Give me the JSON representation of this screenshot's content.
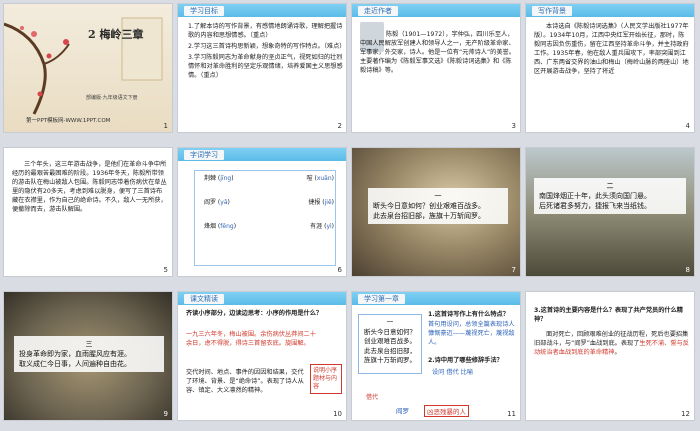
{
  "colors": {
    "header": "#5bbce8",
    "accent_red": "#d0382b",
    "accent_blue": "#2d63b8"
  },
  "slides": [
    {
      "num": "1",
      "title": "2 梅岭三章",
      "author": "部编版·九年级语文下册",
      "footer": "第一PPT模板网-WWW.1PPT.COM"
    },
    {
      "num": "2",
      "tag": "学习目标",
      "items": [
        "1.了解本诗的写作背景，有感情地朗诵诗歌，理解把握诗歌的内容和思想情感。（重点）",
        "2.学习这三首诗构思新颖，想象奇特的写作特点。（难点）",
        "3.学习陈毅同志为革命献身的坚贞正气，视死如归的壮烈情怀和对革命胜利的坚定乐观情绪，培养爱国主义思想感情。（重点）"
      ]
    },
    {
      "num": "3",
      "tag": "走近作者",
      "text": "陈毅（1901—1972），字仲弘，四川乐至人，中国人民解放军创建人和领导人之一，无产阶级革命家、军事家，外交家，诗人。他是一位有“元帅诗人”的美誉。主要著作编为《陈毅军事文选》《陈毅诗词选集》和《陈毅诗稿》等。"
    },
    {
      "num": "4",
      "tag": "写作背景",
      "text": "本诗选自《陈毅诗词选集》（人民文学出版社1977年版）。1934年10月，江西中央红军开始长征，那时，陈毅同志因负伤重伤，留在江西坚持革命斗争，并主持政府工作。1935年春，他在敌人重兵围攻下，率部突围到江西、广东两省交界的油山和梅山（梅岭山脉的两座山）地区开展游击战争，坚持了将近"
    },
    {
      "num": "5",
      "text": "三个年头，这三年游击战争，是他们在革命斗争中所经历的最艰苦最困难的阶段。1936年冬天，陈毅所带领的游击队在梅山被敌人包围。陈毅同志带着伤病伏在草丛里的隐伏有20多天，考虑到难以脱身，便写了三首诗布藏在衣襟里，作为自己的绝命诗。不久，敌人一无所获，便撤除而去，游击队解围。"
    },
    {
      "num": "6",
      "tag": "字词学习",
      "words": [
        {
          "py": "jīng",
          "w": "荆棘"
        },
        {
          "py": "xuān",
          "w": "喧"
        },
        {
          "py": "yā",
          "w": "阎罗"
        },
        {
          "py": "jiē",
          "w": "捷报"
        },
        {
          "py": "fēng",
          "w": "烽烟"
        },
        {
          "py": "yì",
          "w": "有涯"
        }
      ]
    },
    {
      "num": "7",
      "poem_no": "一",
      "lines": [
        "断头今日意如何？创业艰难百战多。",
        "此去泉台招旧部，旌旗十万斩阎罗。"
      ]
    },
    {
      "num": "8",
      "poem_no": "二",
      "lines": [
        "南国烽烟正十年，此头须向国门悬。",
        "后死诸君多努力，捷报飞来当纸钱。"
      ]
    },
    {
      "num": "9",
      "poem_no": "三",
      "lines": [
        "投身革命即为家，血雨腥风应有涯。",
        "取义成仁今日事，人间遍种自由花。"
      ]
    },
    {
      "num": "10",
      "tag": "课文精读",
      "question": "齐读小序部分，边读边思考：小序的作用是什么？",
      "quote": "一九三六年冬，梅山被围。余伤病伏丛莽间二十余日，虑不得脱，得诗三首留衣底。旋围解。",
      "answer": "交代时间、地点、事件的因因和结果，交代了环境、背景、是“绝命诗”。表现了诗人从容、镇定、大义凛然的精神。",
      "callout": "说明小序题材与内容"
    },
    {
      "num": "11",
      "tag": "学习第一章",
      "lines": [
        "一",
        "断头今日意如何？",
        "创业艰难百战多。",
        "此去泉台招旧部，",
        "旌旗十万斩阎罗。"
      ],
      "q1": "1.这首诗写作上有什么特点？",
      "a1": "首句用设问，总领全篇表现诗人慷慨豪迈——蔑视死亡，蔑视敌人。",
      "q2": "2.诗中用了哪些修辞手法？",
      "a2": "设问  借代  比喻",
      "bottom_left": "借代",
      "bottom_mid": "阎罗",
      "bottom_right": "凶恶残暴的人"
    },
    {
      "num": "12",
      "question": "3.这首诗的主要内容是什么？表现了共产党员的什么精神？",
      "answer_pre": "面对死亡，回顾艰难创业的征战历程，死后也要招集旧部战斗，与“阎罗”血战到底。表现了",
      "answer_red": "生死不渝、誓与反动统治者血战到底的革命精神",
      "answer_post": "。"
    }
  ]
}
